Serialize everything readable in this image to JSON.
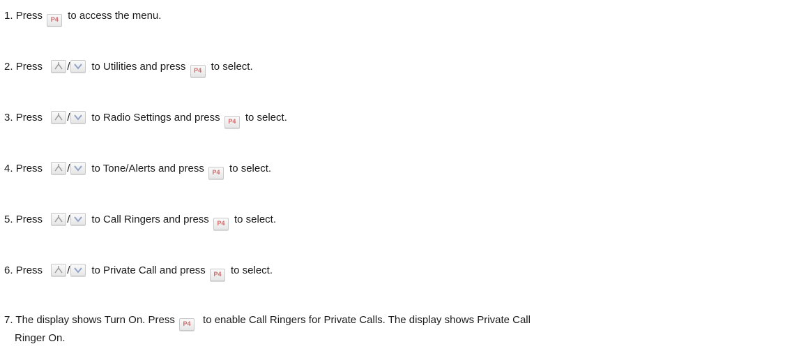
{
  "steps": [
    {
      "num": "1.",
      "pre": "Press",
      "post": "to access the menu."
    },
    {
      "num": "2.",
      "pre": "Press",
      "mid": "to Utilities and press",
      "post": "to select."
    },
    {
      "num": "3.",
      "pre": "Press",
      "mid": "to Radio Settings and press",
      "post": "to select."
    },
    {
      "num": "4.",
      "pre": "Press",
      "mid": "to Tone/Alerts and press",
      "post": "to select."
    },
    {
      "num": "5.",
      "pre": "Press",
      "mid": "to Call Ringers and press",
      "post": "to select."
    },
    {
      "num": "6.",
      "pre": "Press",
      "mid": "to Private Call and press",
      "post": "to select."
    },
    {
      "num": "7.",
      "pre": "The display shows Turn On. Press",
      "post": "to enable Call Ringers for Private Calls. The display shows Private Call",
      "cont": "Ringer On."
    }
  ],
  "keys": {
    "menu_key_label": "P4",
    "separator": "/",
    "up_icon": "up-arrow-key-icon",
    "down_icon": "down-arrow-key-icon"
  }
}
